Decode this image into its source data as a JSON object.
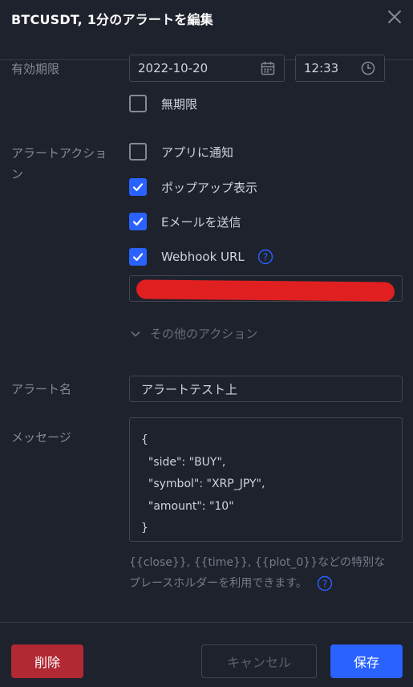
{
  "dialog": {
    "title": "BTCUSDT, 1分のアラートを編集"
  },
  "expiry": {
    "label": "有効期限",
    "date": "2022-10-20",
    "time": "12:33",
    "unlimited_label": "無期限",
    "unlimited_checked": false
  },
  "actions": {
    "label": "アラートアクション",
    "items": [
      {
        "label": "アプリに通知",
        "checked": false
      },
      {
        "label": "ポップアップ表示",
        "checked": true
      },
      {
        "label": "Eメールを送信",
        "checked": true
      },
      {
        "label": "Webhook URL",
        "checked": true
      }
    ],
    "webhook_url": "",
    "more_label": "その他のアクション"
  },
  "alert_name": {
    "label": "アラート名",
    "value": "アラートテスト上"
  },
  "message": {
    "label": "メッセージ",
    "value": "{\n  \"side\": \"BUY\",\n  \"symbol\": \"XRP_JPY\",\n  \"amount\": \"10\"\n}"
  },
  "hint": {
    "text": "{{close}}, {{time}}, {{plot_0}}などの特別なプレースホルダーを利用できます。"
  },
  "buttons": {
    "delete": "削除",
    "cancel": "キャンセル",
    "save": "保存"
  },
  "colors": {
    "background": "#1e222d",
    "accent": "#2962ff",
    "danger": "#b22833",
    "redaction": "#e02020"
  }
}
